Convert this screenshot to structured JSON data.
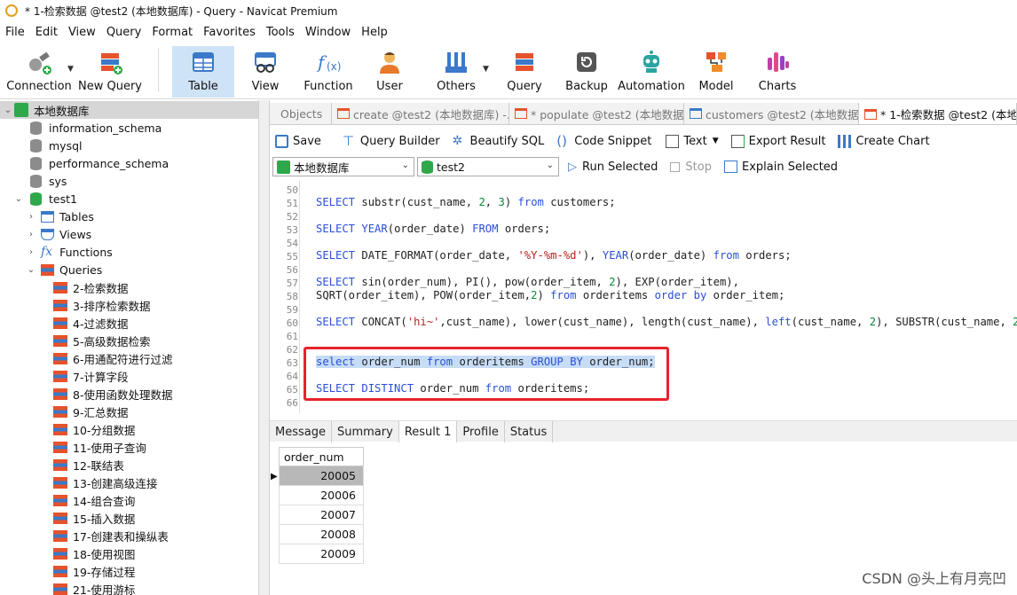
{
  "window": {
    "title": "* 1-检索数据 @test2 (本地数据库) - Query - Navicat Premium"
  },
  "menu": [
    "File",
    "Edit",
    "View",
    "Query",
    "Format",
    "Favorites",
    "Tools",
    "Window",
    "Help"
  ],
  "toolbar": [
    {
      "label": "Connection",
      "icon": "connection-icon"
    },
    {
      "label": "New Query",
      "icon": "new-query-icon"
    },
    {
      "label": "Table",
      "icon": "table-icon",
      "active": true
    },
    {
      "label": "View",
      "icon": "view-icon"
    },
    {
      "label": "Function",
      "icon": "function-icon"
    },
    {
      "label": "User",
      "icon": "user-icon"
    },
    {
      "label": "Others",
      "icon": "others-icon"
    },
    {
      "label": "Query",
      "icon": "query-icon"
    },
    {
      "label": "Backup",
      "icon": "backup-icon"
    },
    {
      "label": "Automation",
      "icon": "automation-icon"
    },
    {
      "label": "Model",
      "icon": "model-icon"
    },
    {
      "label": "Charts",
      "icon": "charts-icon"
    }
  ],
  "tree": {
    "connection": "本地数据库",
    "databases": [
      "information_schema",
      "mysql",
      "performance_schema",
      "sys",
      "test1"
    ],
    "groups": [
      "Tables",
      "Views",
      "Functions",
      "Queries"
    ],
    "queries": [
      "2-检索数据",
      "3-排序检索数据",
      "4-过滤数据",
      "5-高级数据检索",
      "6-用通配符进行过滤",
      "7-计算字段",
      "8-使用函数处理数据",
      "9-汇总数据",
      "10-分组数据",
      "11-使用子查询",
      "12-联结表",
      "13-创建高级连接",
      "14-组合查询",
      "15-插入数据",
      "17-创建表和操纵表",
      "18-使用视图",
      "19-存储过程",
      "21-使用游标"
    ]
  },
  "tabs": [
    "Objects",
    "create @test2 (本地数据库) -...",
    "* populate @test2 (本地数据...",
    "customers @test2 (本地数据...",
    "* 1-检索数据 @test2 (本地数据"
  ],
  "editor_toolbar": {
    "save": "Save",
    "query_builder": "Query Builder",
    "beautify": "Beautify SQL",
    "snippet": "Code Snippet",
    "text": "Text",
    "export": "Export Result",
    "chart": "Create Chart"
  },
  "editor_bar2": {
    "connection": "本地数据库",
    "database": "test2",
    "run": "Run Selected",
    "stop": "Stop",
    "explain": "Explain Selected"
  },
  "code": {
    "line_numbers": [
      "50",
      "51",
      "52",
      "53",
      "54",
      "55",
      "56",
      "57",
      "58",
      "59",
      "60",
      "61",
      "62",
      "63",
      "64",
      "65",
      "66"
    ]
  },
  "result_tabs": [
    "Message",
    "Summary",
    "Result 1",
    "Profile",
    "Status"
  ],
  "result": {
    "column": "order_num",
    "rows": [
      "20005",
      "20006",
      "20007",
      "20008",
      "20009"
    ]
  },
  "watermark": "CSDN @头上有月亮凹"
}
